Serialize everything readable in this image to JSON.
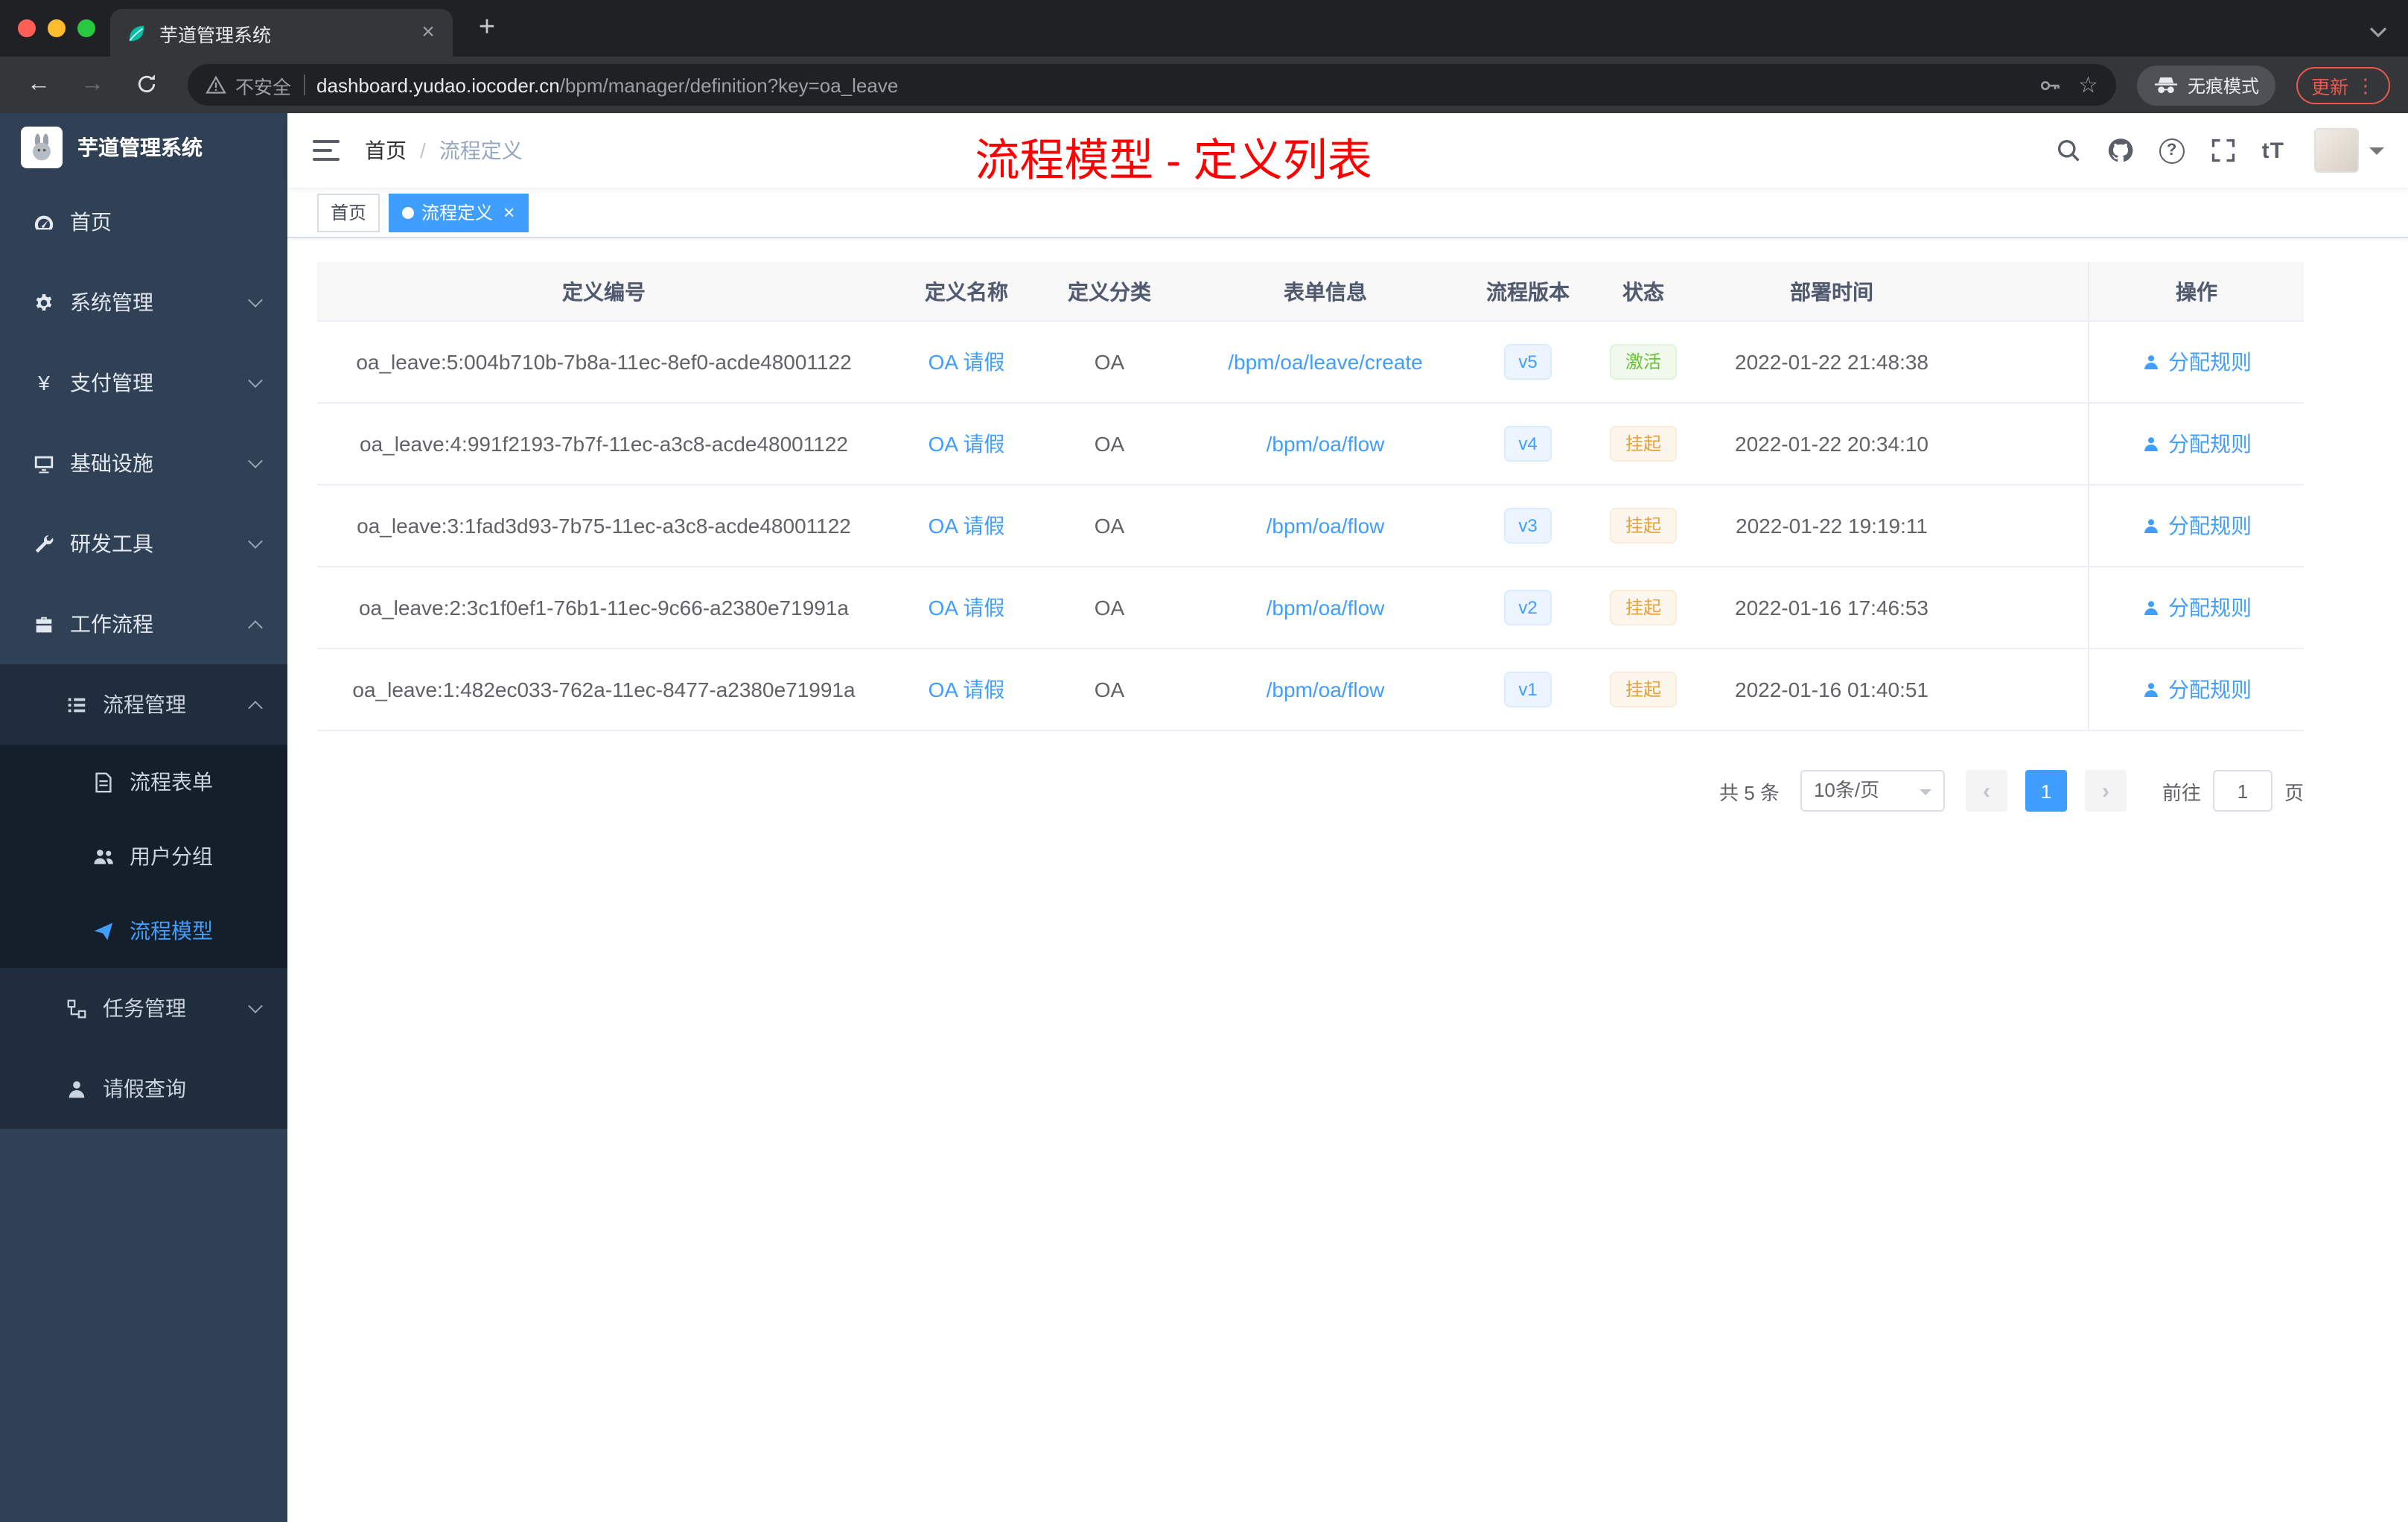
{
  "colors": {
    "accent": "#409eff",
    "annotation_red": "#ff0000",
    "status_active": "#67c23a",
    "status_suspended": "#e6a23c",
    "sidebar_bg": "#304156",
    "submenu_bg": "#1f2d3d"
  },
  "glyphs": {
    "close": "×",
    "plus": "+",
    "back": "←",
    "forward": "→",
    "star": "☆",
    "question": "?",
    "ellipsis_v": "⋮",
    "font_size": "tT"
  },
  "browser": {
    "tab_title": "芋道管理系统",
    "security_label": "不安全",
    "url_host": "dashboard.yudao.iocoder.cn",
    "url_path": "/bpm/manager/definition?key=oa_leave",
    "incognito_label": "无痕模式",
    "update_label": "更新"
  },
  "sidebar": {
    "app_title": "芋道管理系统",
    "menu": [
      {
        "label": "首页"
      },
      {
        "label": "系统管理",
        "expandable": true
      },
      {
        "label": "支付管理",
        "expandable": true
      },
      {
        "label": "基础设施",
        "expandable": true
      },
      {
        "label": "研发工具",
        "expandable": true
      },
      {
        "label": "工作流程",
        "expandable": true,
        "expanded": true,
        "children": [
          {
            "label": "流程管理",
            "expanded": true,
            "children": [
              {
                "label": "流程表单"
              },
              {
                "label": "用户分组"
              },
              {
                "label": "流程模型",
                "active": true
              }
            ]
          },
          {
            "label": "任务管理",
            "expandable": true
          },
          {
            "label": "请假查询"
          }
        ]
      }
    ]
  },
  "navbar": {
    "breadcrumb_home": "首页",
    "breadcrumb_separator": "/",
    "breadcrumb_current": "流程定义",
    "annotation": "流程模型 - 定义列表"
  },
  "tags": [
    {
      "label": "首页",
      "active": false
    },
    {
      "label": "流程定义",
      "active": true
    }
  ],
  "table": {
    "columns": [
      "定义编号",
      "定义名称",
      "定义分类",
      "表单信息",
      "流程版本",
      "状态",
      "部署时间",
      "操作"
    ],
    "action_label": "分配规则",
    "rows": [
      {
        "id": "oa_leave:5:004b710b-7b8a-11ec-8ef0-acde48001122",
        "name": "OA 请假",
        "category": "OA",
        "form": "/bpm/oa/leave/create",
        "version": "v5",
        "status": "激活",
        "status_type": "success",
        "deployed_at": "2022-01-22 21:48:38"
      },
      {
        "id": "oa_leave:4:991f2193-7b7f-11ec-a3c8-acde48001122",
        "name": "OA 请假",
        "category": "OA",
        "form": "/bpm/oa/flow",
        "version": "v4",
        "status": "挂起",
        "status_type": "warning",
        "deployed_at": "2022-01-22 20:34:10"
      },
      {
        "id": "oa_leave:3:1fad3d93-7b75-11ec-a3c8-acde48001122",
        "name": "OA 请假",
        "category": "OA",
        "form": "/bpm/oa/flow",
        "version": "v3",
        "status": "挂起",
        "status_type": "warning",
        "deployed_at": "2022-01-22 19:19:11"
      },
      {
        "id": "oa_leave:2:3c1f0ef1-76b1-11ec-9c66-a2380e71991a",
        "name": "OA 请假",
        "category": "OA",
        "form": "/bpm/oa/flow",
        "version": "v2",
        "status": "挂起",
        "status_type": "warning",
        "deployed_at": "2022-01-16 17:46:53"
      },
      {
        "id": "oa_leave:1:482ec033-762a-11ec-8477-a2380e71991a",
        "name": "OA 请假",
        "category": "OA",
        "form": "/bpm/oa/flow",
        "version": "v1",
        "status": "挂起",
        "status_type": "warning",
        "deployed_at": "2022-01-16 01:40:51"
      }
    ]
  },
  "pagination": {
    "total": "共 5 条",
    "page_size": "10条/页",
    "prev": "‹",
    "current_page": "1",
    "next": "›",
    "goto_label": "前往",
    "goto_value": "1",
    "goto_suffix": "页"
  }
}
